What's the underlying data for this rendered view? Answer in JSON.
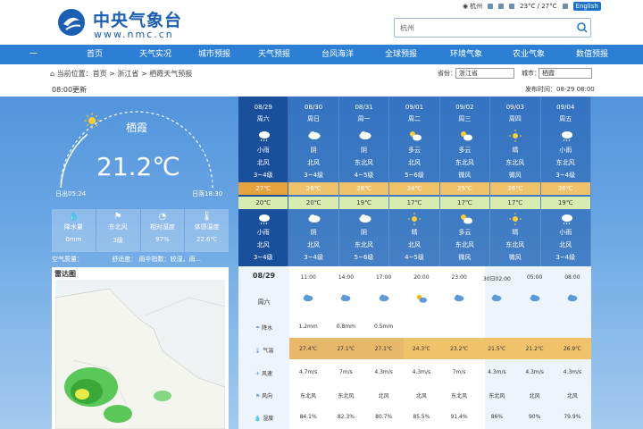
{
  "header": {
    "logo_title": "中央气象台",
    "logo_url": "www.nmc.cn",
    "search_placeholder": "杭州",
    "toplinks": [
      "杭州",
      "23°C / 27°C"
    ],
    "english": "English"
  },
  "nav": [
    "一",
    "首页",
    "天气实况",
    "城市预报",
    "天气预报",
    "台风海洋",
    "全球预报",
    "环境气象",
    "农业气象",
    "数值预报"
  ],
  "breadcrumb": "当前位置：首页 > 浙江省 > 栖霞天气预报",
  "selects": {
    "province_label": "省份：",
    "province": "浙江省",
    "city_label": "城市：",
    "city": "栖霞"
  },
  "publish": "发布时间：08-29 08:00",
  "updated": "08:00更新",
  "current": {
    "city": "栖霞",
    "temp": "21.2℃",
    "sunrise": "日出05:24",
    "sunset": "日落18:30"
  },
  "stats": [
    {
      "icon": "💧",
      "label": "降水量",
      "value": "0mm"
    },
    {
      "icon": "⚑",
      "label": "东北风",
      "value": "3级"
    },
    {
      "icon": "◔",
      "label": "相对湿度",
      "value": "97%"
    },
    {
      "icon": "🌡",
      "label": "体感温度",
      "value": "22.6℃"
    }
  ],
  "aqi": {
    "label": "空气质量：",
    "c1": "舒适度：",
    "c2": "雨伞指数：较湿，雨..."
  },
  "radar_title": "雷达图",
  "days": [
    {
      "date": "08/29",
      "week": "周六",
      "dw": "小雨",
      "dwd": "北风",
      "dws": "3~4级",
      "hi": "27℃",
      "lo": "20℃",
      "nw": "小雨",
      "nwd": "北风",
      "nws": "3~4级",
      "di": "rain",
      "ni": "rain"
    },
    {
      "date": "08/30",
      "week": "周日",
      "dw": "阴",
      "dwd": "北风",
      "dws": "3~4级",
      "hi": "26℃",
      "lo": "20℃",
      "nw": "阴",
      "nwd": "北风",
      "nws": "3~4级",
      "di": "cloud",
      "ni": "cloud"
    },
    {
      "date": "08/31",
      "week": "周一",
      "dw": "阴",
      "dwd": "东北风",
      "dws": "4~5级",
      "hi": "28℃",
      "lo": "19℃",
      "nw": "阴",
      "nwd": "东北风",
      "nws": "5~6级",
      "di": "cloud",
      "ni": "cloud"
    },
    {
      "date": "09/01",
      "week": "周二",
      "dw": "多云",
      "dwd": "北风",
      "dws": "5~6级",
      "hi": "24℃",
      "lo": "17℃",
      "nw": "晴",
      "nwd": "北风",
      "nws": "4~5级",
      "di": "pcloud",
      "ni": "sun"
    },
    {
      "date": "09/02",
      "week": "周三",
      "dw": "多云",
      "dwd": "东北风",
      "dws": "微风",
      "hi": "25℃",
      "lo": "17℃",
      "nw": "多云",
      "nwd": "东北风",
      "nws": "微风",
      "di": "pcloud",
      "ni": "pcloud"
    },
    {
      "date": "09/03",
      "week": "周四",
      "dw": "晴",
      "dwd": "东北风",
      "dws": "微风",
      "hi": "26℃",
      "lo": "17℃",
      "nw": "晴",
      "nwd": "东北风",
      "nws": "微风",
      "di": "sun",
      "ni": "sun"
    },
    {
      "date": "09/04",
      "week": "周五",
      "dw": "小雨",
      "dwd": "东北风",
      "dws": "3~4级",
      "hi": "26℃",
      "lo": "19℃",
      "nw": "小雨",
      "nwd": "北风",
      "nws": "3~4级",
      "di": "rain",
      "ni": "rain"
    }
  ],
  "hourly": {
    "date": "08/29",
    "week": "周六",
    "times": [
      "11:00",
      "14:00",
      "17:00",
      "20:00",
      "23:00",
      "30日02:00",
      "05:00",
      "08:00"
    ],
    "icons": [
      "cloud",
      "cloud",
      "cloud",
      "pcloud",
      "cloud",
      "cloud",
      "cloud",
      "cloud"
    ],
    "rain_label": "降水",
    "rain": [
      "1.2mm",
      "0.8mm",
      "0.5mm",
      "",
      "",
      "",
      "",
      ""
    ],
    "temp_label": "气温",
    "temps": [
      "27.4℃",
      "27.1℃",
      "27.1℃",
      "24.3℃",
      "23.2℃",
      "21.5℃",
      "21.2℃",
      "26.9℃"
    ],
    "wind_label": "风速",
    "winds": [
      "4.7m/s",
      "7m/s",
      "4.3m/s",
      "4.3m/s",
      "7m/s",
      "4.3m/s",
      "4.3m/s",
      "4.3m/s"
    ],
    "wdir_label": "风向",
    "wdirs": [
      "东北风",
      "东北风",
      "北风",
      "北风",
      "东北风",
      "东北风",
      "北风",
      "北风"
    ],
    "hum_label": "湿度",
    "hums": [
      "84.1%",
      "82.3%",
      "80.7%",
      "85.5%",
      "91.4%",
      "86%",
      "90%",
      "79.9%"
    ]
  },
  "colors": {
    "nav": "#2d7fd6",
    "accent": "#1a5fb4",
    "hi": "#e6a23c",
    "lo": "#d9ecb0"
  }
}
